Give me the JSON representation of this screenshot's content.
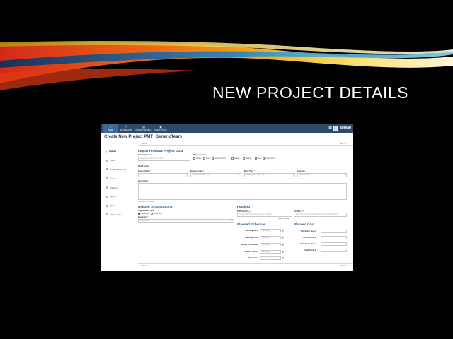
{
  "slide": {
    "title": "NEW PROJECT DETAILS"
  },
  "app": {
    "nav_tabs": [
      {
        "label": "HOME",
        "icon": "home-icon"
      },
      {
        "label": "INFORMATION",
        "icon": "plus-icon"
      },
      {
        "label": "PROJECT REVIEWS",
        "icon": "document-icon"
      },
      {
        "label": "MEMO STATUS",
        "icon": "clipboard-icon"
      }
    ],
    "brand": "appian",
    "page_title": "Create New Project PMT_GenericTeam",
    "back_top": "< BACK",
    "next_top": "NEXT >",
    "back_bottom": "< BACK",
    "next_bottom": "NEXT >",
    "sidebar": [
      "Details",
      "Team",
      "Customer POCs",
      "Fellows",
      "Tailoring",
      "Risks",
      "Plans",
      "Deliverables"
    ],
    "import_section": {
      "title": "Import Previous Project Data",
      "existing_label": "Existing Project",
      "existing_placeholder": "Select Existing Project to Import",
      "data_label": "Data to Import",
      "checkboxes": [
        "Details",
        "Team",
        "Customer POCs",
        "Fellows",
        "Tailoring",
        "Risks",
        "Project Plans"
      ]
    },
    "details": {
      "title": "Details",
      "project_name_label": "Project Name *",
      "business_line_label": "Business Line *",
      "business_line_placeholder": "Select a Business Line",
      "work_type_label": "Work Type *",
      "work_type_placeholder": "Select Project Work Type",
      "interlock_label": "Interlock",
      "interlock_placeholder": "Select Interlock",
      "description_label": "Description *",
      "char_count": "Character count: 0/4000"
    },
    "related": {
      "title": "Related Organizations",
      "org_type_label": "Organization Type *",
      "org_options": [
        "Operational",
        "Group Staff"
      ],
      "requisitor_label": "Requisitor *",
      "requisitor_placeholder": "Select Value"
    },
    "funding": {
      "title": "Funding",
      "sms_label": "SMS Search ⓘ",
      "sms_placeholder": "Type a public tax/line item etc here to Search",
      "io_label": "IO ORS ⓘ *",
      "io_placeholder": "Enter IO's (Comma-separated) (Example: 7723051-0421-2)",
      "search_clear": "Search | Clear"
    },
    "schedule": {
      "title": "Planned Schedule",
      "rows": [
        "Planning Starts",
        "Planning Finish",
        "Delivery to Customer",
        "Delivery Service",
        "Project End"
      ],
      "date_placeholder": "mm/dd/yyyy"
    },
    "cost": {
      "title": "Planned Cost",
      "rows": [
        "Total Labor Hours",
        "Total Material $",
        "Total Travel Hours",
        "Total Travel $"
      ]
    }
  }
}
